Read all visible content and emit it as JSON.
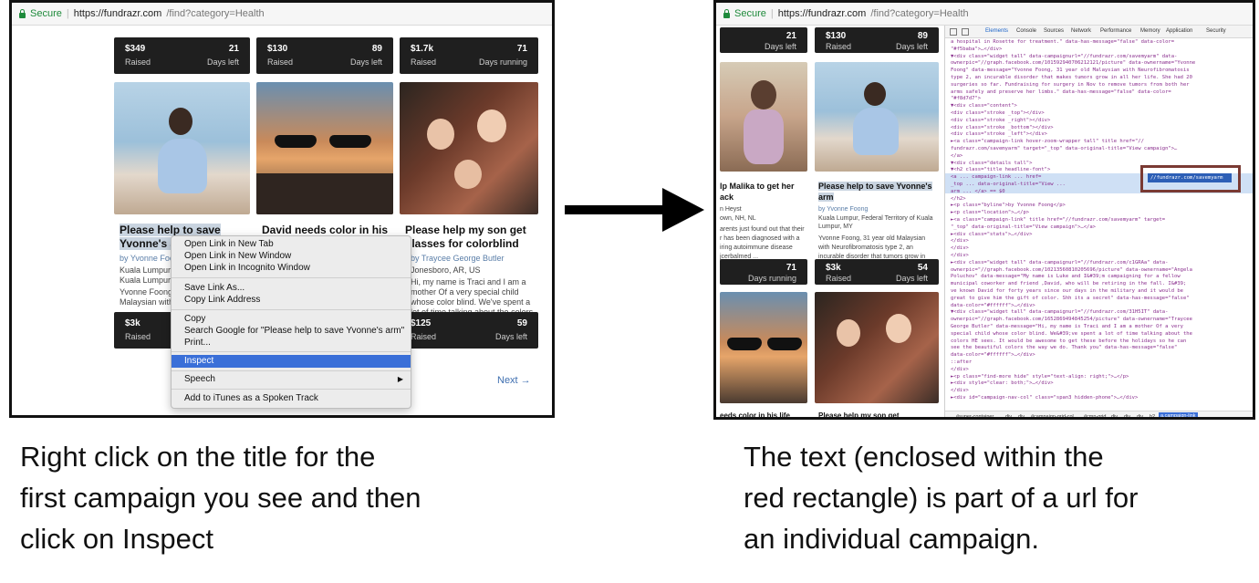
{
  "browser": {
    "secure_label": "Secure",
    "url_host": "https://fundrazr.com",
    "url_path": "/find?category=Health"
  },
  "left_panel": {
    "top_stats": [
      {
        "raised": "$349",
        "raised_label": "Raised",
        "days": "21",
        "days_label": "Days left"
      },
      {
        "raised": "$130",
        "raised_label": "Raised",
        "days": "89",
        "days_label": "Days left"
      },
      {
        "raised": "$1.7k",
        "raised_label": "Raised",
        "days": "71",
        "days_label": "Days running"
      }
    ],
    "cards": [
      {
        "title_line1": "Please help to save",
        "title_line2": "Yvonne's a",
        "byline": "by Yvonne Foo",
        "location": "Kuala Lumpur,",
        "location2": "Kuala Lumpur",
        "desc1": "Yvonne Foong,",
        "desc2": "Malaysian with",
        "raised": "$3k",
        "raised_label": "Raised"
      },
      {
        "title_line1": "David needs color in his"
      },
      {
        "title_line1": "Please help my son get",
        "title_line2": "glasses for colorblind",
        "byline": "by Traycee George Butler",
        "location": "Jonesboro, AR, US",
        "desc1": "Hi, my name is Traci and I am a",
        "desc2": "mother Of a very special child",
        "desc3": "whose color blind. We've spent a",
        "desc4": "lot of time talking about the colors",
        "raised": "$125",
        "raised_label": "Raised",
        "days": "59",
        "days_label": "Days left"
      }
    ],
    "context_menu": {
      "items": [
        "Open Link in New Tab",
        "Open Link in New Window",
        "Open Link in Incognito Window",
        "Save Link As...",
        "Copy Link Address",
        "Copy",
        "Search Google for \"Please help to save Yvonne's arm\"",
        "Print...",
        "Inspect",
        "Speech",
        "Add to iTunes as a Spoken Track"
      ],
      "submenu_arrow": "▶"
    },
    "next_link": "Next →"
  },
  "arrow": {
    "direction": "right"
  },
  "right_panel": {
    "page": {
      "top_left_days": "21",
      "top_left_days_label": "Days left",
      "top_right_raised": "$130",
      "top_right_raised_label": "Raised",
      "top_right_days": "89",
      "top_right_days_label": "Days left",
      "card_a_title1": "lp Malika to get her",
      "card_a_title2": "ack",
      "card_a_by": "n Heyst",
      "card_a_loc": "own, NH, NL",
      "card_a_desc": [
        "arents just found out that their",
        "r has been diagnosed with a",
        "iring autoimmune disease",
        "jcerbalmed ..."
      ],
      "card_a_days": "71",
      "card_a_days_label": "Days running",
      "card_b_title1": "Please help to save Yvonne's",
      "card_b_title2": "arm",
      "card_b_by": "by Yvonne Foong",
      "card_b_loc": "Kuala Lumpur, Federal Territory of Kuala",
      "card_b_loc2": "Lumpur, MY",
      "card_b_desc": [
        "Yvonne Foong, 31 year old Malaysian",
        "with Neurofibromatosis type 2, an",
        "incurable disorder that tumors grow in"
      ],
      "card_b_raised": "$3k",
      "card_b_raised_label": "Raised",
      "card_b_days": "54",
      "card_b_days_label": "Days left",
      "bottom_a": "eeds color in his life",
      "bottom_b": "Please help my son get"
    },
    "devtools": {
      "tabs": [
        "Elements",
        "Console",
        "Sources",
        "Network",
        "Performance",
        "Memory",
        "Application",
        "Security"
      ],
      "lines": [
        "a hospital in Rosette for treatment.\" data-has-message=\"false\" data-color=",
        "\"#f5baba\">…</div>",
        "▼<div class=\"widget tall\" data-campaignurl=\"//fundrazr.com/savemyarm\" data-",
        "ownerpic=\"//graph.facebook.com/101592940706212121/picture\" data-ownername=\"Yvonne",
        "Foong\" data-message=\"Yvonne Foong, 31 year old Malaysian with Neurofibromatosis",
        "type 2, an incurable disorder that makes tumors grow in all her life. She had 20",
        "surgeries so far. Fundraising for surgery in Nov to remove tumors from both her",
        "arms safely and preserve her limbs.\" data-has-message=\"false\" data-color=",
        "\"#f8d7d7\">",
        "  ▼<div class=\"content\">",
        "      <div class=\"stroke _top\"></div>",
        "      <div class=\"stroke _right\"></div>",
        "      <div class=\"stroke _bottom\"></div>",
        "      <div class=\"stroke _left\"></div>",
        "    ►<a class=\"campaign-link hover-zoom-wrapper tall\" title href=\"//",
        "    fundrazr.com/savemyarm\" target=\"_top\" data-original-title=\"View campaign\">…",
        "    </a>",
        "    ▼<div class=\"details tall\">",
        "      ▼<h2 class=\"title headline-font\">",
        "          <a ... campaign-link ... href=",
        "          _top ... data-original-title=\"View ... ",
        "          arm ... </a> == $0",
        "        </h2>",
        "      ►<p class=\"byline\">by Yvonne Foong</p>",
        "      ►<p class=\"location\">…</p>",
        "      ►<a class=\"campaign-link\" title href=\"//fundrazr.com/savemyarm\" target=",
        "      \"_top\" data-original-title=\"View campaign\">…</a>",
        "      ►<div class=\"stats\">…</div>",
        "      </div>",
        "    </div>",
        "  </div>",
        "►<div class=\"widget tall\" data-campaignurl=\"//fundrazr.com/c1GRAa\" data-",
        "ownerpic=\"//graph.facebook.com/10213560810205696/picture\" data-ownername=\"Angela",
        "Poluchov\" data-message=\"My name is Luke and I&#39;m campaigning for a fellow",
        "municipal  coworker and friend ,David, who will be retiring in the fall. I&#39;",
        "ve known David for forty years since our days in the military and it would be",
        "great to give him the gift of color. Shh its a secret\" data-has-message=\"false\"",
        "data-color=\"#ffffff\">…</div>",
        "▼<div class=\"widget tall\" data-campaignurl=\"//fundrazr.com/31H5IT\" data-",
        "ownerpic=\"//graph.facebook.com/1652869494845254/picture\" data-ownername=\"Traycee",
        "George Butler\" data-message=\"Hi, my name is Traci and I am a mother Of a very",
        "special child whose color blind. We&#39;ve spent a lot of time talking about the",
        "colors HE sees. It would be awesome to get these before the holidays so he can",
        "see the beautiful colors the way we do. Thank you\" data-has-message=\"false\"",
        "data-color=\"#ffffff\">…</div>",
        "  ::after",
        "  </div>",
        "►<p class=\"find-more hide\" style=\"text-align: right;\">…</p>",
        "►<div style=\"clear: both;\">…</div>",
        "</div>",
        "►<div id=\"campaign-nav-col\" class=\"span3 hidden-phone\">…</div>"
      ],
      "selected_url": "//fundrazr.com/savemyarm",
      "breadcrumbs": [
        "#super-container",
        "div",
        "div",
        "#campaign-grid-col",
        "#cmp-grid",
        "div",
        "div",
        "div",
        "h2",
        "a.campaign-link"
      ]
    }
  },
  "captions": {
    "left": [
      "Right click on the title for the",
      "first campaign you see and then",
      "click on Inspect"
    ],
    "right": [
      "The text (enclosed within the",
      "red rectangle) is part of a url for",
      "an individual campaign."
    ]
  }
}
